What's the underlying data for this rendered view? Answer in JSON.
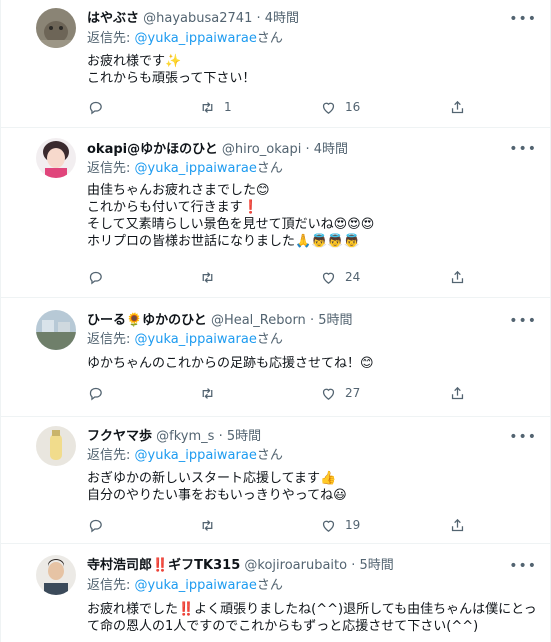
{
  "reply_prefix": "返信先: ",
  "reply_suffix": "さん",
  "tweets": [
    {
      "name": "はやぶさ",
      "handle": "@hayabusa2741",
      "dot": "·",
      "time": "4時間",
      "reply_to": "@yuka_ippaiwarae",
      "body": "お疲れ様です✨\nこれからも頑張って下さい！",
      "retweets": "1",
      "likes": "16"
    },
    {
      "name": "okapi@ゆかほのひと",
      "handle": "@hiro_okapi",
      "dot": "·",
      "time": "4時間",
      "reply_to": "@yuka_ippaiwarae",
      "body": "由佳ちゃんお疲れさまでした😊\nこれからも付いて行きます❗\nそして又素晴らしい景色を見せて頂だいね😍😍😍\nホリプロの皆様お世話になりました🙏👼👼👼",
      "retweets": "",
      "likes": "24"
    },
    {
      "name": "ひーる🌻ゆかのひと",
      "handle": "@Heal_Reborn",
      "dot": "·",
      "time": "5時間",
      "reply_to": "@yuka_ippaiwarae",
      "body": "ゆかちゃんのこれからの足跡も応援させてね！😊",
      "retweets": "",
      "likes": "27"
    },
    {
      "name": "フクヤマ歩",
      "handle": "@fkym_s",
      "dot": "·",
      "time": "5時間",
      "reply_to": "@yuka_ippaiwarae",
      "body": "おぎゆかの新しいスタート応援してます👍\n自分のやりたい事をおもいっきりやってね😃",
      "retweets": "",
      "likes": "19"
    },
    {
      "name": "寺村浩司郎‼️ギフTK315",
      "handle": "@kojiroarubaito",
      "dot": "·",
      "time": "5時間",
      "reply_to": "@yuka_ippaiwarae",
      "body": "お疲れ様でした‼️よく頑張りましたね(^^)退所しても由佳ちゃんは僕にとって命の恩人の1人ですのでこれからもずっと応援させて下さい(^^)",
      "retweets": "",
      "likes": ""
    }
  ]
}
